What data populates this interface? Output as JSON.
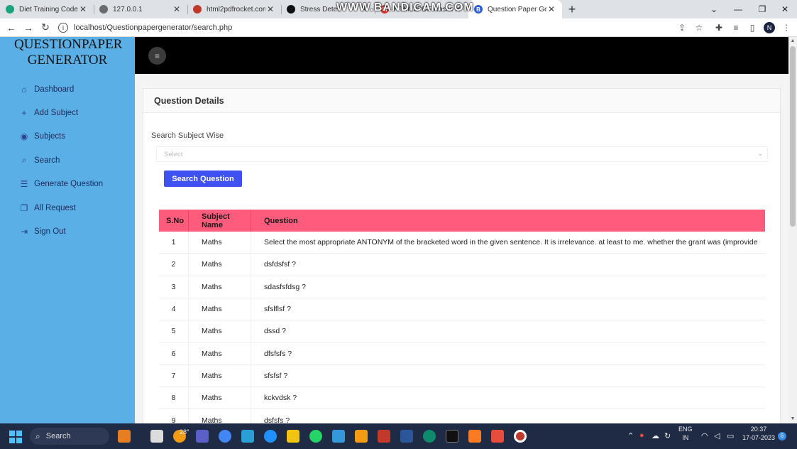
{
  "browser": {
    "tabs": [
      {
        "label": "Diet Training Code",
        "icon": "openai-icon",
        "color": "#19a37f",
        "glyph": ""
      },
      {
        "label": "127.0.0.1",
        "icon": "globe-icon",
        "color": "#6b6b6b",
        "glyph": ""
      },
      {
        "label": "html2pdfrocket.com/",
        "icon": "rocket-icon",
        "color": "#c0392b",
        "glyph": ""
      },
      {
        "label": "Stress Detec",
        "icon": "video-icon",
        "color": "#111111",
        "glyph": ""
      },
      {
        "label": "HTML2PDF Rocket AP",
        "icon": "gmail-icon",
        "color": "#d93025",
        "glyph": "M"
      },
      {
        "label": "Question Paper Gene",
        "icon": "bootstrap-icon",
        "color": "#2b5fd9",
        "glyph": "B"
      }
    ],
    "watermark": "WWW.BANDICAM.COM",
    "url": "localhost/Questionpapergenerator/search.php"
  },
  "sidebar": {
    "brand": "QUESTIONPAPER GENERATOR",
    "items": [
      {
        "label": "Dashboard",
        "icon": "home-icon",
        "glyph": "⌂"
      },
      {
        "label": "Add Subject",
        "icon": "plus-icon",
        "glyph": "+"
      },
      {
        "label": "Subjects",
        "icon": "eye-icon",
        "glyph": "◉"
      },
      {
        "label": "Search",
        "icon": "search-icon",
        "glyph": "⌕"
      },
      {
        "label": "Generate Question",
        "icon": "list-icon",
        "glyph": "☰"
      },
      {
        "label": "All Request",
        "icon": "copy-icon",
        "glyph": "❐"
      },
      {
        "label": "Sign Out",
        "icon": "sign-out-icon",
        "glyph": "⇥"
      }
    ]
  },
  "main": {
    "card_title": "Question Details",
    "search_label": "Search Subject Wise",
    "select_placeholder": "Select",
    "search_button": "Search Question",
    "table": {
      "headers": [
        "S.No",
        "Subject Name",
        "Question"
      ],
      "rows": [
        [
          "1",
          "Maths",
          "Select the most appropriate ANTONYM of the bracketed word in the given sentence. It is irrelevance. at least to me. whether the grant was (improvide"
        ],
        [
          "2",
          "Maths",
          "dsfdsfsf ?"
        ],
        [
          "3",
          "Maths",
          "sdasfsfdsg ?"
        ],
        [
          "4",
          "Maths",
          "sfslflsf ?"
        ],
        [
          "5",
          "Maths",
          "dssd ?"
        ],
        [
          "6",
          "Maths",
          "dfsfsfs ?"
        ],
        [
          "7",
          "Maths",
          "sfsfsf ?"
        ],
        [
          "8",
          "Maths",
          "kckvdsk ?"
        ],
        [
          "9",
          "Maths",
          "dsfsfs ?"
        ]
      ]
    }
  },
  "taskbar": {
    "search": "Search",
    "weather": "28°",
    "lang": "ENG",
    "region": "IN",
    "time": "20:37",
    "date": "17-07-2023",
    "notifications": "6"
  }
}
